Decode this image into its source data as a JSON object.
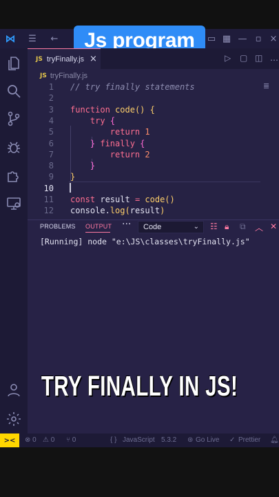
{
  "video": {
    "title": "Js program",
    "caption": "TRY FINALLY IN JS!"
  },
  "editor": {
    "tab": {
      "badge": "JS",
      "label": "tryFinally.js",
      "close": "×"
    },
    "breadcrumb": {
      "badge": "JS",
      "label": "tryFinally.js"
    },
    "lines": [
      {
        "n": "1",
        "tokens": [
          {
            "c": "cmt",
            "t": "// try finally statements"
          }
        ]
      },
      {
        "n": "2",
        "tokens": []
      },
      {
        "n": "3",
        "tokens": [
          {
            "c": "kw",
            "t": "function "
          },
          {
            "c": "fn",
            "t": "code"
          },
          {
            "c": "br",
            "t": "() {"
          }
        ]
      },
      {
        "n": "4",
        "tokens": [
          {
            "c": "pl",
            "t": "    "
          },
          {
            "c": "kw",
            "t": "try "
          },
          {
            "c": "br2",
            "t": "{"
          }
        ]
      },
      {
        "n": "5",
        "tokens": [
          {
            "c": "pl",
            "t": "        "
          },
          {
            "c": "kw",
            "t": "return "
          },
          {
            "c": "num",
            "t": "1"
          }
        ]
      },
      {
        "n": "6",
        "tokens": [
          {
            "c": "pl",
            "t": "    "
          },
          {
            "c": "br2",
            "t": "} "
          },
          {
            "c": "kw",
            "t": "finally "
          },
          {
            "c": "br2",
            "t": "{"
          }
        ]
      },
      {
        "n": "7",
        "tokens": [
          {
            "c": "pl",
            "t": "        "
          },
          {
            "c": "kw",
            "t": "return "
          },
          {
            "c": "num",
            "t": "2"
          }
        ]
      },
      {
        "n": "8",
        "tokens": [
          {
            "c": "pl",
            "t": "    "
          },
          {
            "c": "br2",
            "t": "}"
          }
        ]
      },
      {
        "n": "9",
        "tokens": [
          {
            "c": "br",
            "t": "}"
          }
        ]
      },
      {
        "n": "10",
        "tokens": []
      },
      {
        "n": "11",
        "tokens": [
          {
            "c": "kw",
            "t": "const "
          },
          {
            "c": "pl",
            "t": "result "
          },
          {
            "c": "kw",
            "t": "= "
          },
          {
            "c": "fn",
            "t": "code"
          },
          {
            "c": "br",
            "t": "()"
          }
        ]
      },
      {
        "n": "12",
        "tokens": [
          {
            "c": "pl",
            "t": "console."
          },
          {
            "c": "fn",
            "t": "log"
          },
          {
            "c": "br",
            "t": "("
          },
          {
            "c": "pl",
            "t": "result"
          },
          {
            "c": "br",
            "t": ")"
          }
        ]
      }
    ],
    "active_line": "10"
  },
  "panel": {
    "tabs": {
      "problems": "PROBLEMS",
      "output": "OUTPUT",
      "more": "···"
    },
    "channel": "Code",
    "output_line": "[Running] node \"e:\\JS\\classes\\tryFinally.js\""
  },
  "status": {
    "remote": "><",
    "errors": "⊗ 0",
    "warnings": "⚠ 0",
    "ports": "⑂ 0",
    "braces": "{ }",
    "language": "JavaScript",
    "version": "5.3.2",
    "golive": "Go Live",
    "prettier": "Prettier"
  },
  "colors": {
    "accent": "#ff7aa2",
    "title_bg": "#2f8cf7",
    "remote_bg": "#ffd600",
    "editor_bg": "#262244"
  },
  "icons": [
    "vscode-icon",
    "explorer-icon",
    "search-icon",
    "source-control-icon",
    "debug-icon",
    "extensions-icon",
    "remote-explorer-icon",
    "account-icon",
    "settings-icon",
    "run-icon",
    "split-icon",
    "minimap-icon",
    "clear-output-icon",
    "lock-icon",
    "chevron-up-icon",
    "close-icon"
  ]
}
